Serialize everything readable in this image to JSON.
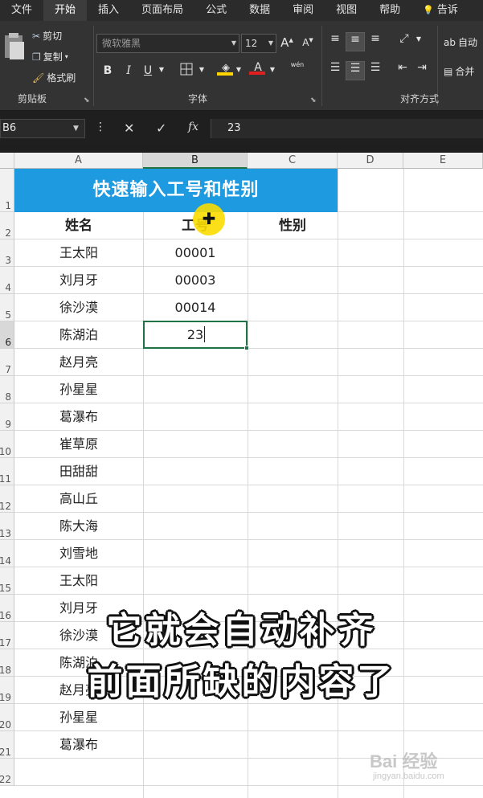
{
  "menubar": {
    "tabs": [
      "文件",
      "开始",
      "插入",
      "页面布局",
      "公式",
      "数据",
      "审阅",
      "视图",
      "帮助"
    ],
    "active_tab": "开始",
    "tell_me": "告诉"
  },
  "ribbon": {
    "clipboard": {
      "cut": "剪切",
      "copy": "复制",
      "format_painter": "格式刷",
      "group_label": "剪贴板"
    },
    "font": {
      "font_name": "微软雅黑",
      "font_size": "12",
      "grow_label": "A",
      "shrink_label": "A",
      "bold": "B",
      "italic": "I",
      "underline": "U",
      "font_color_label": "A",
      "phonetic_label": "wén",
      "group_label": "字体"
    },
    "alignment": {
      "wrap_label": "自动",
      "merge_label": "合并",
      "group_label": "对齐方式"
    }
  },
  "formula_bar": {
    "name_box": "B6",
    "cancel": "✕",
    "enter": "✓",
    "fx": "fx",
    "content": "23"
  },
  "sheet": {
    "columns": [
      "A",
      "B",
      "C",
      "D",
      "E"
    ],
    "selected_column": "B",
    "rows": [
      "1",
      "2",
      "3",
      "4",
      "5",
      "6",
      "7",
      "8",
      "9",
      "10",
      "11",
      "12",
      "13",
      "14",
      "15",
      "16",
      "17",
      "18",
      "19",
      "20",
      "21",
      "22"
    ],
    "selected_row": "6",
    "title": "快速输入工号和性别",
    "headers": {
      "name": "姓名",
      "id": "工号",
      "gender": "性别"
    },
    "names": [
      "王太阳",
      "刘月牙",
      "徐沙漠",
      "陈湖泊",
      "赵月亮",
      "孙星星",
      "葛瀑布",
      "崔草原",
      "田甜甜",
      "高山丘",
      "陈大海",
      "刘雪地",
      "王太阳",
      "刘月牙",
      "徐沙漠",
      "陈湖泊",
      "赵月亮",
      "孙星星",
      "葛瀑布"
    ],
    "ids": [
      "00001",
      "00003",
      "00014",
      "23"
    ]
  },
  "subtitles": {
    "line1": "它就会自动补齐",
    "line2": "前面所缺的内容了"
  },
  "watermark": {
    "brand": "Bai 经验",
    "url": "jingyan.baidu.com"
  }
}
